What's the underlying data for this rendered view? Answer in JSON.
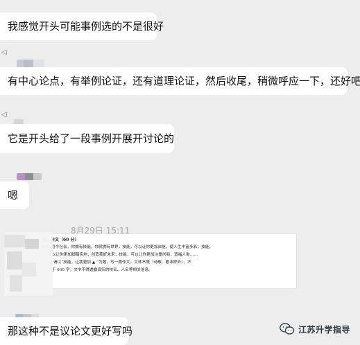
{
  "messages": [
    {
      "text": "我感觉开头可能事例选的不是很好"
    },
    {
      "text": "有中心论点，有举例论证，还有道理论证，然后收尾，稍微呼应一下，还好吧"
    },
    {
      "text": "它是开头给了一段事例开展开讨论的"
    },
    {
      "text": "嗯"
    },
    {
      "text": "那这种不是议论文更好写吗"
    }
  ],
  "timestamp": "8月29日 15:11",
  "document": {
    "heading": "九．作文（60 分）",
    "lines": [
      "43．司今社会，你拥有技能，你就拥有世界，技能，可以让你更加自信，使人生丰富多彩；技能，",
      "可以让你更加脚踏实地，创造美好未来；技能，可以让你更加注重创新，造福人类……",
      "请以“技能，让我更加 ▲ ”为题，写一篇作文。文体不限（诗歌、剧本除外），不",
      "少于 600 字，文中不得透露真实的校名、人名等相关信息。"
    ]
  },
  "watermark": {
    "text": "江苏升学指导",
    "icon": "wechat-icon"
  },
  "colors": {
    "background": "#ededed",
    "bubble": "#ffffff"
  }
}
